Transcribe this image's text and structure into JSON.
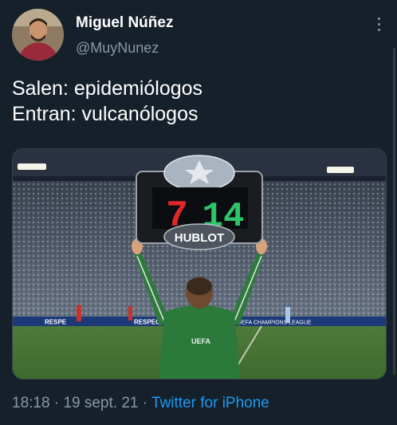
{
  "author": {
    "name": "Miguel Núñez",
    "handle": "@MuyNunez"
  },
  "tweet": {
    "lines": [
      "Salen: epidemiólogos",
      "Entran: vulcanólogos"
    ]
  },
  "media": {
    "board": {
      "out_number": "7",
      "in_number": "14",
      "brand": "HUBLOT"
    },
    "ad_left": "RESPE",
    "ad_mid": "RESPEC",
    "ad_right": "UEFA CHAMPIONS LEAGUE",
    "jersey_text": "UEFA"
  },
  "meta": {
    "time": "18:18",
    "date": "19 sept. 21",
    "separator": "·",
    "source": "Twitter for iPhone"
  },
  "colors": {
    "background": "#15202b",
    "secondary_text": "#8899a6",
    "link": "#1d9bf0"
  }
}
